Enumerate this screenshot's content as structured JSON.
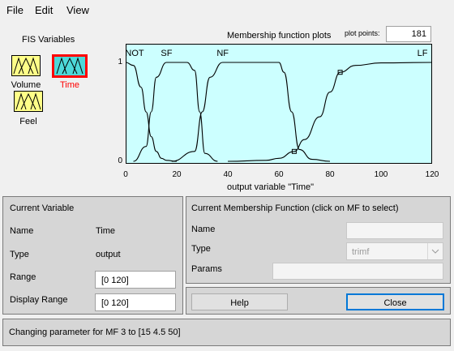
{
  "menu": {
    "file": "File",
    "edit": "Edit",
    "view": "View"
  },
  "fis": {
    "heading": "FIS Variables",
    "variables": [
      {
        "name": "Volume",
        "selected": false
      },
      {
        "name": "Time",
        "selected": true
      },
      {
        "name": "Feel",
        "selected": false
      }
    ]
  },
  "plot": {
    "title": "Membership function plots",
    "points_label": "plot points:",
    "points_value": "181"
  },
  "chart_data": {
    "type": "line",
    "title": "Membership function plots",
    "xlabel": "output variable \"Time\"",
    "ylabel": "",
    "xlim": [
      0,
      120
    ],
    "ylim": [
      0,
      1
    ],
    "xticks": [
      0,
      20,
      40,
      60,
      80,
      100,
      120
    ],
    "yticks": [
      0,
      0.5,
      1
    ],
    "grid": false,
    "series": [
      {
        "name": "NOT",
        "x": [
          0,
          3,
          6,
          8,
          10,
          12,
          14,
          16,
          20
        ],
        "y": [
          1,
          0.97,
          0.75,
          0.5,
          0.25,
          0.1,
          0.03,
          0.01,
          0
        ]
      },
      {
        "name": "SF",
        "x": [
          3,
          8,
          10,
          12,
          16,
          24,
          27,
          29,
          31,
          36
        ],
        "y": [
          0,
          0.15,
          0.5,
          0.85,
          1,
          1,
          0.92,
          0.5,
          0.08,
          0
        ]
      },
      {
        "name": "NF",
        "x": [
          18,
          27,
          30,
          33,
          38,
          60,
          62,
          65,
          68,
          73,
          80
        ],
        "y": [
          0,
          0.1,
          0.5,
          0.85,
          1,
          1,
          0.9,
          0.5,
          0.12,
          0.02,
          0
        ]
      },
      {
        "name": "LF",
        "x": [
          40,
          55,
          60,
          66,
          70,
          76,
          80,
          84,
          90,
          100,
          120
        ],
        "y": [
          0,
          0.01,
          0.03,
          0.1,
          0.22,
          0.45,
          0.7,
          0.9,
          0.97,
          0.995,
          1
        ]
      }
    ],
    "markers": [
      {
        "x": 66,
        "y": 0.1
      },
      {
        "x": 84,
        "y": 0.9
      }
    ]
  },
  "current_variable": {
    "title": "Current Variable",
    "name_label": "Name",
    "name_value": "Time",
    "type_label": "Type",
    "type_value": "output",
    "range_label": "Range",
    "range_value": "[0 120]",
    "display_range_label": "Display Range",
    "display_range_value": "[0 120]"
  },
  "current_mf": {
    "title": "Current Membership Function (click on MF to select)",
    "name_label": "Name",
    "name_value": "",
    "type_label": "Type",
    "type_value": "trimf",
    "params_label": "Params",
    "params_value": ""
  },
  "buttons": {
    "help": "Help",
    "close": "Close"
  },
  "status": "Changing parameter for MF 3 to  [15 4.5 50]",
  "colors": {
    "plot_bg": "#ccffff",
    "selected_border": "#ff0000",
    "selected_label": "#ff0000",
    "var_fill_io": "#ffff88",
    "var_fill_selected": "#4dd9d9"
  }
}
